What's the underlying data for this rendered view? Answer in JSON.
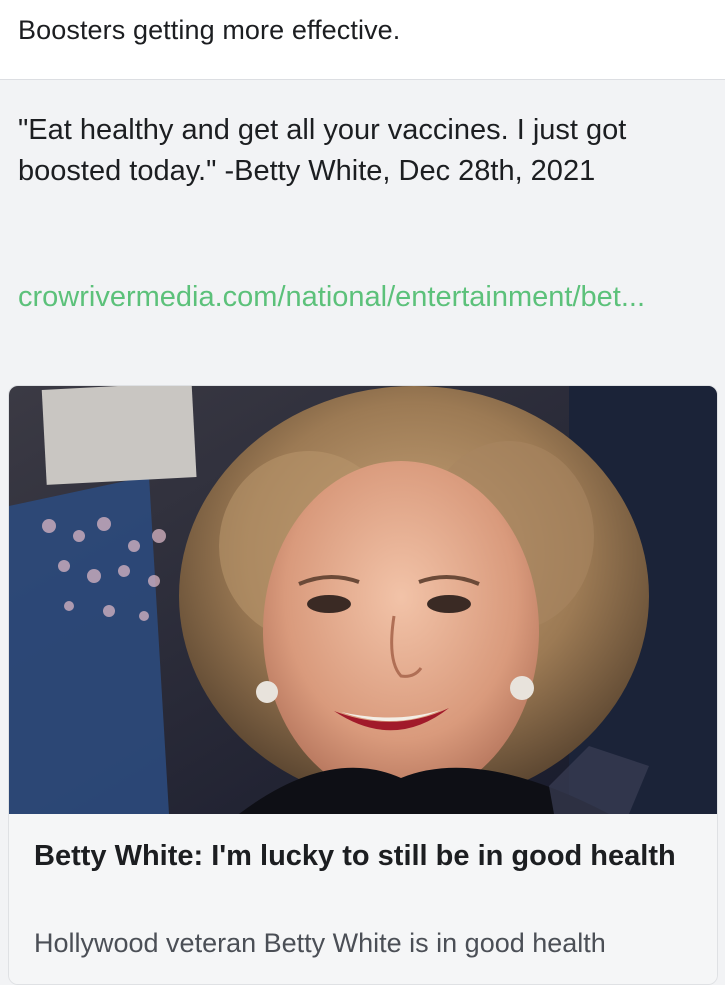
{
  "post": {
    "caption": "Boosters getting more effective.",
    "quote": "\"Eat healthy and get all your vaccines. I just got boosted today.\" -Betty White, Dec 28th, 2021",
    "link_text": "crowrivermedia.com/national/entertainment/bet..."
  },
  "link_preview": {
    "image_icon": "portrait-photo",
    "title": "Betty White: I'm lucky to still be in good health",
    "description": "Hollywood veteran Betty White is in good health"
  },
  "colors": {
    "link": "#5cc17a",
    "background": "#f2f3f5",
    "text": "#1c1e21"
  }
}
